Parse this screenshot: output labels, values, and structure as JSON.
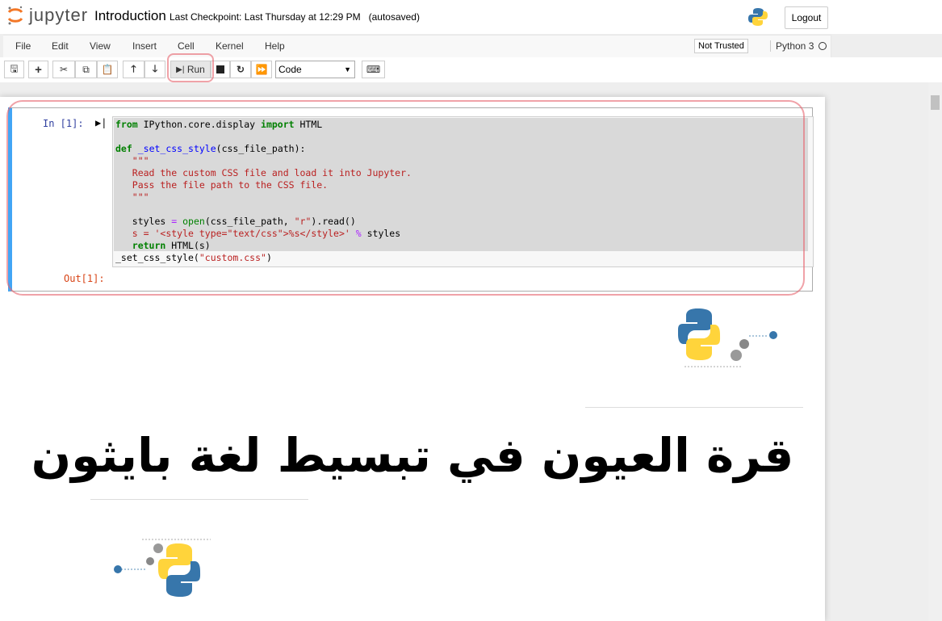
{
  "header": {
    "logo_text": "jupyter",
    "notebook_title": "Introduction",
    "checkpoint": "Last Checkpoint: Last Thursday at 12:29 PM",
    "autosave": "(autosaved)",
    "logout": "Logout"
  },
  "menu": {
    "items": [
      "File",
      "Edit",
      "View",
      "Insert",
      "Cell",
      "Kernel",
      "Help"
    ],
    "trust": "Not Trusted",
    "kernel": "Python 3"
  },
  "toolbar": {
    "run_label": "Run",
    "cell_type": "Code"
  },
  "cell": {
    "in_prompt": "In [1]:",
    "out_prompt": "Out[1]:"
  },
  "content": {
    "arabic_title": "قرة العيون في تبسيط لغة بايثون"
  },
  "colors": {
    "accent": "#42a5f5",
    "jupyter_orange": "#f37726"
  }
}
